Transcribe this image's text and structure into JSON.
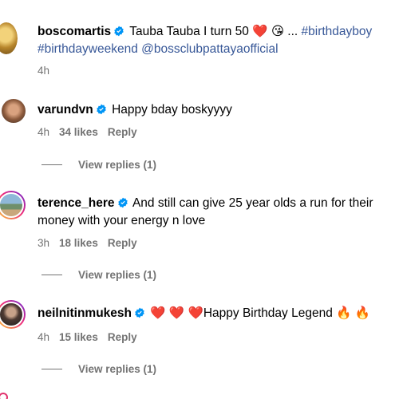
{
  "comments": [
    {
      "username": "boscomartis",
      "text_before": "Tauba Tauba I turn 50 ",
      "emoji1": "❤️",
      "emoji2": "😘",
      "ellipsis": " ... ",
      "hashtag1": "#birthdayboy",
      "hashtag2": "#birthdayweekend",
      "mention": "@bossclubpattayaofficial",
      "time": "4h"
    },
    {
      "username": "varundvn",
      "text": "Happy bday boskyyyy",
      "time": "4h",
      "likes": "34 likes",
      "reply": "Reply",
      "view_replies": "View replies (1)"
    },
    {
      "username": "terence_here",
      "text": "And still can give 25 year olds a run for their money with your energy n love",
      "time": "3h",
      "likes": "18 likes",
      "reply": "Reply",
      "view_replies": "View replies (1)"
    },
    {
      "username": "neilnitinmukesh",
      "hearts": "❤️ ❤️ ❤️",
      "text": "Happy Birthday Legend",
      "fires": "🔥 🔥",
      "time": "4h",
      "likes": "15 likes",
      "reply": "Reply",
      "view_replies": "View replies (1)"
    }
  ],
  "colors": {
    "verified": "#0095f6",
    "hashtag": "#385898",
    "meta": "#737373"
  }
}
